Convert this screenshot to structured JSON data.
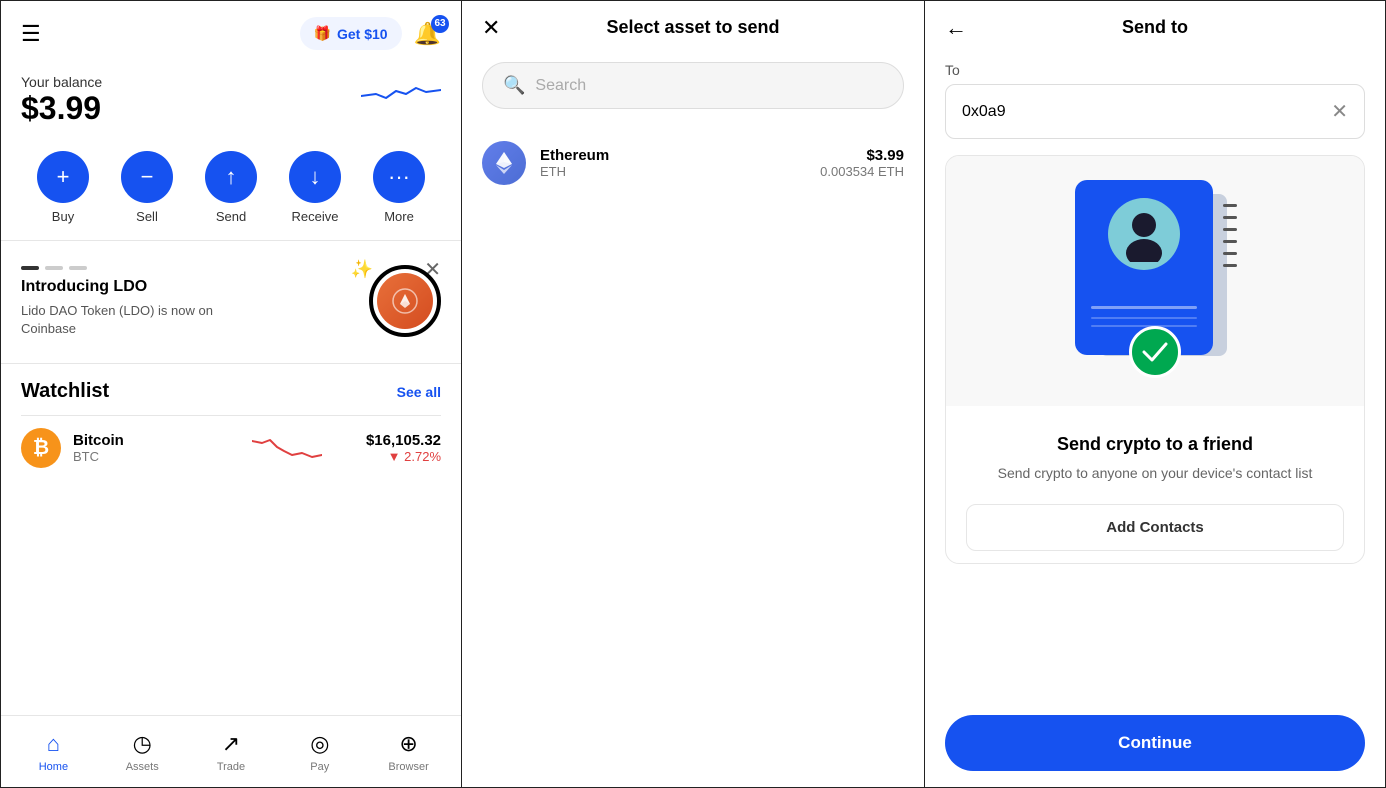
{
  "panel1": {
    "header": {
      "get_money_label": "Get $10",
      "badge_count": "63"
    },
    "balance": {
      "label": "Your balance",
      "amount": "$3.99"
    },
    "actions": [
      {
        "label": "Buy",
        "icon": "+"
      },
      {
        "label": "Sell",
        "icon": "−"
      },
      {
        "label": "Send",
        "icon": "↑"
      },
      {
        "label": "Receive",
        "icon": "↓"
      },
      {
        "label": "More",
        "icon": "•••"
      }
    ],
    "promo": {
      "title": "Introducing LDO",
      "description": "Lido DAO Token (LDO) is now on Coinbase"
    },
    "watchlist": {
      "title": "Watchlist",
      "see_all": "See all",
      "items": [
        {
          "name": "Bitcoin",
          "symbol": "BTC",
          "price": "$16,105.32",
          "change": "▼ 2.72%",
          "change_positive": false
        }
      ]
    },
    "nav": [
      {
        "label": "Home",
        "icon": "⌂",
        "active": true
      },
      {
        "label": "Assets",
        "icon": "◷",
        "active": false
      },
      {
        "label": "Trade",
        "icon": "↗",
        "active": false
      },
      {
        "label": "Pay",
        "icon": "◎",
        "active": false
      },
      {
        "label": "Browser",
        "icon": "⊕",
        "active": false
      }
    ]
  },
  "panel2": {
    "title": "Select asset to send",
    "search_placeholder": "Search",
    "assets": [
      {
        "name": "Ethereum",
        "symbol": "ETH",
        "usd_value": "$3.99",
        "crypto_value": "0.003534 ETH"
      }
    ]
  },
  "panel3": {
    "title": "Send to",
    "to_label": "To",
    "to_address": "0x0a9",
    "card": {
      "main_text": "Send crypto to a friend",
      "sub_text": "Send crypto to anyone on your device's contact list",
      "add_contact_label": "Add Contacts"
    },
    "continue_label": "Continue"
  }
}
